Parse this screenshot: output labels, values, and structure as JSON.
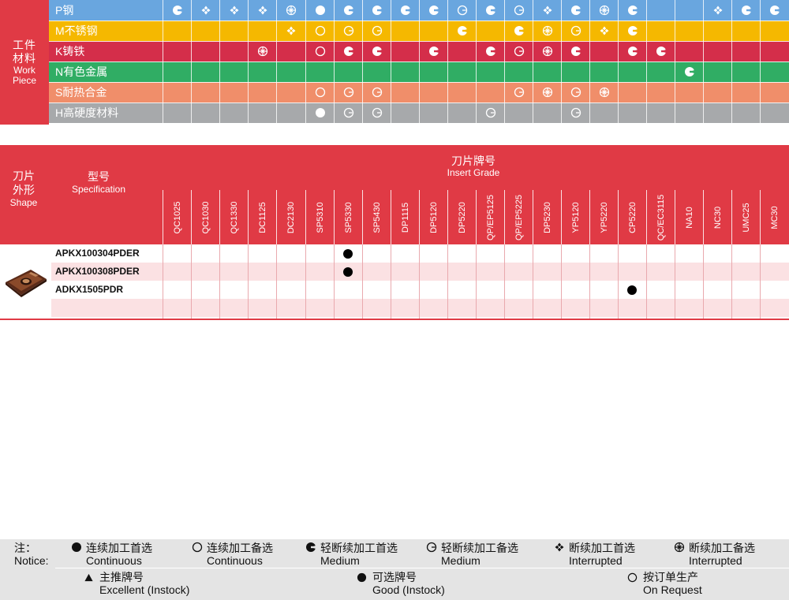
{
  "colors": {
    "red": "#e03a45",
    "blue": "#69a6df",
    "yellow": "#f5b800",
    "crimson": "#d42e4a",
    "green": "#30ad64",
    "salmon": "#f08e6a",
    "grey": "#a7a9ab",
    "pink_row": "#fbe1e3",
    "notice_bg": "#e4e4e4"
  },
  "work_piece": {
    "header_zh": [
      "工件",
      "材料"
    ],
    "header_en": [
      "Work",
      "Piece"
    ],
    "rows": [
      {
        "label": "P钢",
        "color": "#69a6df",
        "cells": [
          "cm",
          "if",
          "if",
          "if",
          "ia",
          "cf",
          "cm",
          "cm",
          "cm",
          "cm",
          "ca",
          "cm",
          "ca",
          "if",
          "cm",
          "ia",
          "cm",
          "",
          "",
          "if",
          "cm",
          "cm"
        ]
      },
      {
        "label": "M不锈钢",
        "color": "#f5b800",
        "cells": [
          "",
          "",
          "",
          "",
          "if",
          "co",
          "ca",
          "ca",
          "",
          "",
          "cm",
          "",
          "cm",
          "ia",
          "ca",
          "if",
          "cm",
          "",
          "",
          "",
          "",
          ""
        ]
      },
      {
        "label": "K铸铁",
        "color": "#d42e4a",
        "cells": [
          "",
          "",
          "",
          "ia",
          "",
          "co",
          "cm",
          "cm",
          "",
          "cm",
          "",
          "cm",
          "ca",
          "ia",
          "cm",
          "",
          "cm",
          "cm",
          "",
          "",
          "",
          ""
        ]
      },
      {
        "label": "N有色金属",
        "color": "#30ad64",
        "cells": [
          "",
          "",
          "",
          "",
          "",
          "",
          "",
          "",
          "",
          "",
          "",
          "",
          "",
          "",
          "",
          "",
          "",
          "",
          "cm",
          "",
          "",
          ""
        ]
      },
      {
        "label": "S耐热合金",
        "color": "#f08e6a",
        "cells": [
          "",
          "",
          "",
          "",
          "",
          "co",
          "ca",
          "ca",
          "",
          "",
          "",
          "",
          "ca",
          "ia",
          "ca",
          "ia",
          "",
          "",
          "",
          "",
          "",
          ""
        ]
      },
      {
        "label": "H高硬度材料",
        "color": "#a7a9ab",
        "cells": [
          "",
          "",
          "",
          "",
          "",
          "cf",
          "ca",
          "ca",
          "",
          "",
          "",
          "ca",
          "",
          "",
          "ca",
          "",
          "",
          "",
          "",
          "",
          "",
          ""
        ]
      }
    ]
  },
  "insert_table": {
    "shape_zh": [
      "刀片",
      "外形"
    ],
    "shape_en": "Shape",
    "spec_zh": "型号",
    "spec_en": "Specification",
    "grade_zh": "刀片牌号",
    "grade_en": "Insert Grade",
    "grades": [
      "QC1025",
      "QC1030",
      "QC1330",
      "DC1125",
      "DC2130",
      "SP5310",
      "SP5330",
      "SP5430",
      "DP1115",
      "DP5120",
      "DP5220",
      "QP/EP5125",
      "QP/EP5225",
      "DP5230",
      "YP5120",
      "YP5220",
      "CP5220",
      "QC/EC3115",
      "NA10",
      "NC30",
      "UMC25",
      "MC30"
    ],
    "rows": [
      {
        "spec": "APKX100304PDER",
        "marks": [
          6
        ]
      },
      {
        "spec": "APKX100308PDER",
        "marks": [
          6
        ]
      },
      {
        "spec": "ADKX1505PDR",
        "marks": [
          16
        ]
      },
      {
        "spec": "",
        "marks": []
      }
    ]
  },
  "notice": {
    "label_zh": "注：",
    "label_en": "Notice:",
    "legend": [
      {
        "icon": "filled-circle-icon",
        "zh": "连续加工首选",
        "en": "Continuous"
      },
      {
        "icon": "open-circle-icon",
        "zh": "连续加工备选",
        "en": "Continuous"
      },
      {
        "icon": "medium-filled-icon",
        "zh": "轻断续加工首选",
        "en": "Medium"
      },
      {
        "icon": "medium-open-icon",
        "zh": "轻断续加工备选",
        "en": "Medium"
      },
      {
        "icon": "interrupted-filled-icon",
        "zh": "断续加工首选",
        "en": "Interrupted"
      },
      {
        "icon": "interrupted-open-icon",
        "zh": "断续加工备选",
        "en": "Interrupted"
      }
    ],
    "availability": [
      {
        "icon": "triangle-icon",
        "zh": "主推牌号",
        "en": "Excellent (Instock)"
      },
      {
        "icon": "filled-circle-icon",
        "zh": "可选牌号",
        "en": "Good (Instock)"
      },
      {
        "icon": "open-circle-icon",
        "zh": "按订单生产",
        "en": "On Request"
      }
    ]
  }
}
